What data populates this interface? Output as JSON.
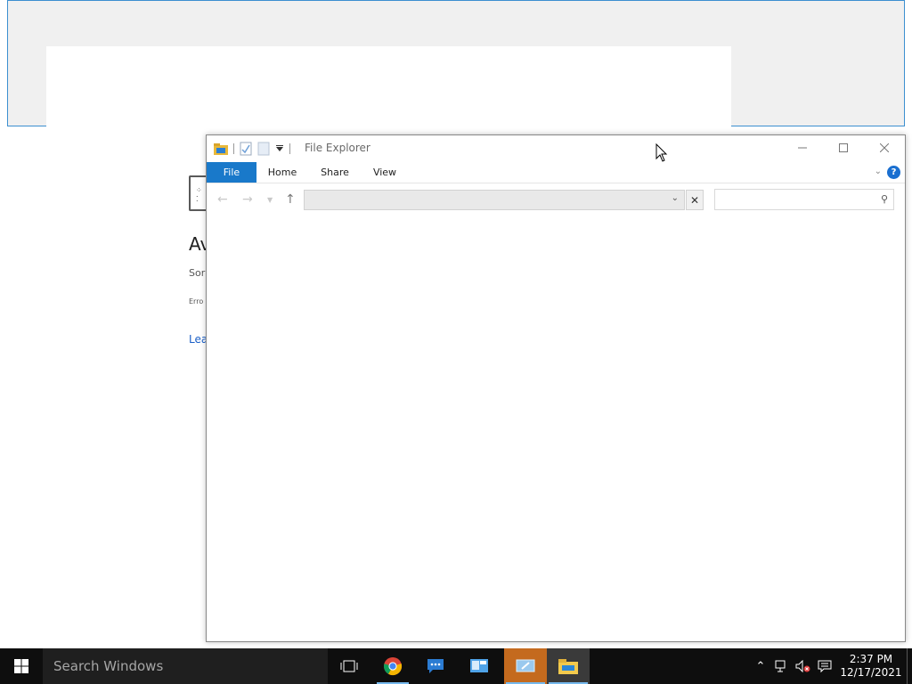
{
  "background_page": {
    "title_fragment": "Av",
    "subtitle_fragment": "Sor",
    "error_fragment": "Erro",
    "link_fragment": "Lea"
  },
  "explorer": {
    "title": "File Explorer",
    "tabs": [
      "File",
      "Home",
      "Share",
      "View"
    ],
    "address_value": "",
    "search_placeholder": "",
    "help": "?"
  },
  "taskbar": {
    "search_placeholder": "Search Windows",
    "time": "2:37 PM",
    "date": "12/17/2021"
  },
  "colors": {
    "accent": "#1979ca",
    "taskbar": "#0e0e0e",
    "active_app": "#c46a1e"
  }
}
